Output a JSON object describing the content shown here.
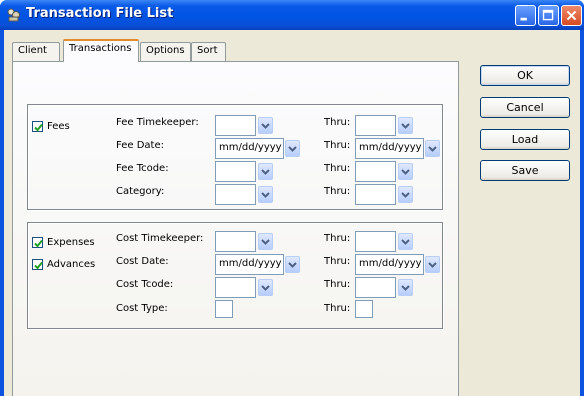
{
  "window": {
    "title": "Transaction File List"
  },
  "tabs": [
    "Client",
    "Transactions",
    "Options",
    "Sort"
  ],
  "fees": {
    "checkbox_label": "Fees",
    "checked": true,
    "rows": [
      {
        "label": "Fee Timekeeper:",
        "thru": "Thru:",
        "from_value": "",
        "to_value": ""
      },
      {
        "label": "Fee Date:",
        "thru": "Thru:",
        "from_value": "mm/dd/yyyy",
        "to_value": "mm/dd/yyyy"
      },
      {
        "label": "Fee Tcode:",
        "thru": "Thru:",
        "from_value": "",
        "to_value": ""
      },
      {
        "label": "Category:",
        "thru": "Thru:",
        "from_value": "",
        "to_value": ""
      }
    ]
  },
  "costs": {
    "checkboxes": [
      {
        "label": "Expenses",
        "checked": true
      },
      {
        "label": "Advances",
        "checked": true
      }
    ],
    "rows": [
      {
        "label": "Cost Timekeeper:",
        "thru": "Thru:",
        "from_value": "",
        "to_value": ""
      },
      {
        "label": "Cost Date:",
        "thru": "Thru:",
        "from_value": "mm/dd/yyyy",
        "to_value": "mm/dd/yyyy"
      },
      {
        "label": "Cost Tcode:",
        "thru": "Thru:",
        "from_value": "",
        "to_value": ""
      },
      {
        "label": "Cost Type:",
        "thru": "Thru:",
        "from_value": "",
        "to_value": ""
      }
    ]
  },
  "buttons": {
    "ok": "OK",
    "cancel": "Cancel",
    "load": "Load",
    "save": "Save"
  },
  "colors": {
    "titlebar": "#0054e3",
    "dialog_bg": "#ece9d8",
    "active_tab_accent": "#e68b2c",
    "check": "#21a121"
  }
}
